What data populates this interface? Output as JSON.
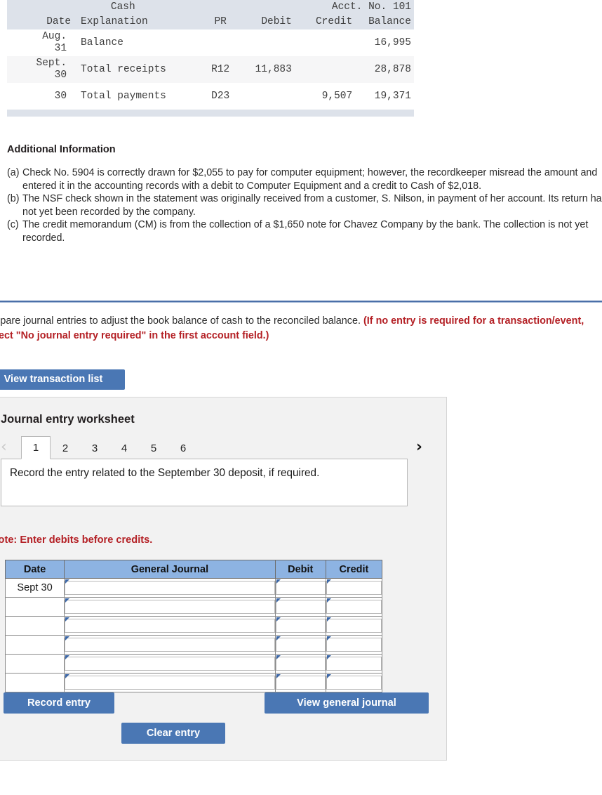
{
  "ledger": {
    "title": "Cash",
    "account_label": "Acct. No. 101",
    "columns": [
      "Date",
      "Explanation",
      "PR",
      "Debit",
      "Credit",
      "Balance"
    ],
    "rows": [
      {
        "date_month": "Aug.",
        "date_day": "31",
        "explanation": "Balance",
        "pr": "",
        "debit": "",
        "credit": "",
        "balance": "16,995"
      },
      {
        "date_month": "Sept.",
        "date_day": "30",
        "explanation": "Total receipts",
        "pr": "R12",
        "debit": "11,883",
        "credit": "",
        "balance": "28,878"
      },
      {
        "date_month": "",
        "date_day": "30",
        "explanation": "Total payments",
        "pr": "D23",
        "debit": "",
        "credit": "9,507",
        "balance": "19,371"
      }
    ]
  },
  "additional_information": {
    "heading": "Additional Information",
    "items": [
      {
        "label": "(a)",
        "text": "Check No. 5904 is correctly drawn for $2,055 to pay for computer equipment; however, the recordkeeper misread the amount and entered it in the accounting records with a debit to Computer Equipment and a credit to Cash of $2,018."
      },
      {
        "label": "(b)",
        "text": "The NSF check shown in the statement was originally received from a customer, S. Nilson, in payment of her account. Its return has not yet been recorded by the company."
      },
      {
        "label": "(c)",
        "text": "The credit memorandum (CM) is from the collection of a $1,650 note for Chavez Company by the bank. The collection is not yet recorded."
      }
    ]
  },
  "prompt": {
    "main_text": "Prepare journal entries to adjust the book balance of cash to the reconciled balance. ",
    "red_text": "(If no entry is required for a transaction/event, select \"No journal entry required\" in the first account field.)"
  },
  "view_transaction_list_button": "View transaction list",
  "worksheet": {
    "title": "Journal entry worksheet",
    "tabs": [
      "1",
      "2",
      "3",
      "4",
      "5",
      "6"
    ],
    "active_tab": "1",
    "prev_arrow": "‹",
    "next_arrow": "›",
    "instruction": "Record the entry related to the September 30 deposit, if required.",
    "note": "Note: Enter debits before credits.",
    "table": {
      "headers": [
        "Date",
        "General Journal",
        "Debit",
        "Credit"
      ],
      "rows": [
        {
          "date": "Sept 30",
          "general_journal": "",
          "debit": "",
          "credit": ""
        },
        {
          "date": "",
          "general_journal": "",
          "debit": "",
          "credit": ""
        },
        {
          "date": "",
          "general_journal": "",
          "debit": "",
          "credit": ""
        },
        {
          "date": "",
          "general_journal": "",
          "debit": "",
          "credit": ""
        },
        {
          "date": "",
          "general_journal": "",
          "debit": "",
          "credit": ""
        },
        {
          "date": "",
          "general_journal": "",
          "debit": "",
          "credit": ""
        }
      ]
    },
    "buttons": {
      "record_entry": "Record entry",
      "clear_entry": "Clear entry",
      "view_general_journal": "View general journal"
    }
  },
  "colors": {
    "primary_blue": "#4a77b4",
    "table_header_blue": "#8db3e2",
    "ledger_header_gray": "#dde2ea",
    "red_note": "#b42025",
    "divider_blue": "#4a6fa8"
  }
}
